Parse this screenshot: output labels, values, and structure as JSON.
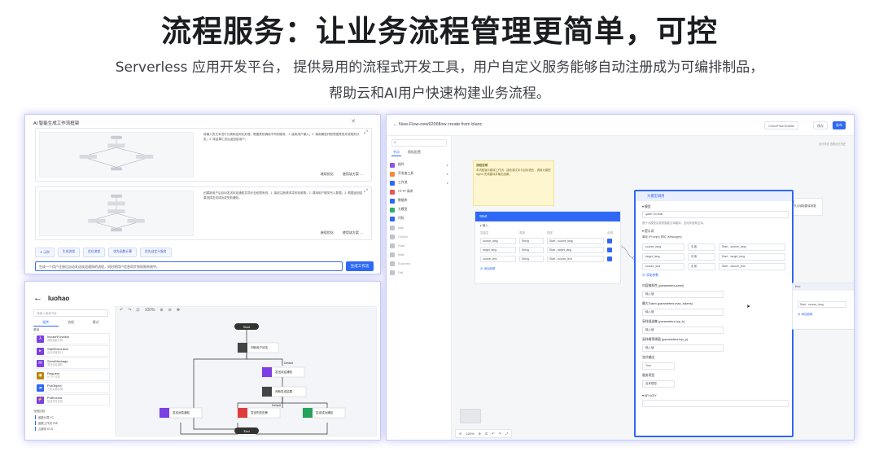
{
  "headline": "流程服务：让业务流程管理更简单，可控",
  "subline1": "Serverless 应用开发平台， 提供易用的流程式开发工具，用户自定义服务能够自动注册成为可编排制品，",
  "subline2": "帮助云和AI用户快速构建业务流程。",
  "panel1": {
    "title": "AI 智能生成工作流框架",
    "close": "✕",
    "cards": [
      {
        "text": "将输入的文本进行分类和结构化处理，根据类别调用不同的服务。1. 接收用户输入；2. 调用模型判断意图类别并按规则分发；3. 将结果汇总后返回给用户。",
        "optimize": "继续优化",
        "use": "使用该方案 →"
      },
      {
        "text": "创建新用户后自动发送欢迎通知并同步至权限系统。1. 接收注册请求并校验参数；2. 调用用户服务写入数据；3. 根据返回结果选择发送成功或失败通知。",
        "optimize": "继续优化",
        "use": "使用该方案 →"
      }
    ],
    "tags": [
      "✦ 示例",
      "生成流程",
      "优化流程",
      "优先函数计算",
      "优先自定义服务"
    ],
    "input": "生成一个用户注册后自动发送欢迎通知的流程，同时将用户信息同步到权限系统中。",
    "generate": "生成工作流"
  },
  "panel2": {
    "back": "←",
    "title": "luohao",
    "search": "请输入搜索内容",
    "tabs": [
      "组件",
      "流程",
      "模式"
    ],
    "group": "基础",
    "nodes": [
      {
        "name": "InvokeFunction",
        "sub": "调用函数计算",
        "color": "#7b3fe4"
      },
      {
        "name": "StartExecution",
        "sub": "启动流程执行",
        "color": "#7b3fe4"
      },
      {
        "name": "SendMessage",
        "sub": "发送消息通知",
        "color": "#7b3fe4"
      },
      {
        "name": "Request",
        "sub": "HTTP 请求",
        "color": "#b8860b"
      },
      {
        "name": "PutObject",
        "sub": "上传对象存储",
        "color": "#2f68f5"
      },
      {
        "name": "PutEvents",
        "sub": "投递事件总线",
        "color": "#7b3fe4"
      }
    ],
    "section": "流程控制",
    "subs": [
      "函数计算 FC",
      "函数工作流 FNF",
      "云服务 ECS"
    ],
    "toolbar": [
      "↶",
      "↷",
      "⊡",
      "100%",
      "⊕",
      "⊖",
      "✥"
    ],
    "flow": {
      "start": "Start",
      "end": "End",
      "judge1": "判断用户状态",
      "invoke": "发送欢迎通知",
      "judge2": "判断发送结果",
      "default": "Default",
      "b1": "发送消息通知",
      "b2": "发送失败告警",
      "b3": "发送成功通知"
    }
  },
  "panel3": {
    "title": "←  New-Flow-new9206flow create from blanc",
    "topbtn1": "CloudFlow Builder",
    "topbtn2": "保存",
    "topbtn3": "发布",
    "search": "⌕",
    "tabs": [
      "节点",
      "模板配置"
    ],
    "items": [
      {
        "label": "插件",
        "color": "#8a58e8"
      },
      {
        "label": "开发者工具",
        "color": "#f58a3c"
      },
      {
        "label": "工作流",
        "color": "#2f68f5"
      },
      {
        "label": "HTTP 请求",
        "color": "#e95656"
      },
      {
        "label": "数据库",
        "color": "#2f68f5"
      },
      {
        "label": "大模型",
        "color": "#2fb06a"
      },
      {
        "label": "代码",
        "color": "#2f68f5"
      },
      {
        "label": "Map",
        "color": "#c0c4cc"
      },
      {
        "label": "Choice",
        "color": "#c0c4cc"
      },
      {
        "label": "Pass",
        "color": "#c0c4cc"
      },
      {
        "label": "Wait",
        "color": "#c0c4cc"
      },
      {
        "label": "Succeed",
        "color": "#c0c4cc"
      },
      {
        "label": "Fail",
        "color": "#c0c4cc"
      }
    ],
    "hint": "运行状态    查看运行历史",
    "note_title": "流程说明",
    "note": "本流程演示翻译工作流：接收源文本与目标语言，调用大模型 Agent 完成翻译并输出结果。",
    "start_title": "Start",
    "start_input": "▸ 输入",
    "start_cols": [
      "变量名",
      "类型",
      "描述",
      "必填"
    ],
    "start_rows": [
      [
        "source_lang",
        "String",
        "Start - source_lang"
      ],
      [
        "target_lang",
        "String",
        "Start - target_lang"
      ],
      [
        "source_text",
        "String",
        "Start - source_text"
      ]
    ],
    "start_add": "⊕ 添加参数",
    "llm_title": "大模型调用",
    "llm_model_label": "▾ 模型",
    "llm_model": "qwen-7b-chat",
    "llm_desc": "基于大模型实现的智能文本翻译，支持多语种互译。",
    "llm_prompt_label": "▾ 提示词",
    "llm_prompt": "单轮 (Prompt)    多轮 (Messages)",
    "llm_rows": [
      [
        "source_lang",
        "引用",
        "Start - source_lang"
      ],
      [
        "target_lang",
        "引用",
        "Start - target_lang"
      ],
      [
        "source_text",
        "引用",
        "Start - source_text"
      ]
    ],
    "llm_add": "⊕ 添加参数",
    "params": [
      {
        "label": "内容随机性 (parameters.seed)",
        "value": "输入值"
      },
      {
        "label": "最大Token (parameters.max_tokens)",
        "value": "输入值"
      },
      {
        "label": "采样候选集 (parameters.top_k)",
        "value": "输入值"
      },
      {
        "label": "采样概率阈值 (parameters.top_p)",
        "value": "输入值"
      },
      {
        "label": "流式输出",
        "value": "True"
      },
      {
        "label": "服务类型",
        "value": "百炼模型"
      },
      {
        "label": "▾ API-KEY",
        "value": ""
      }
    ],
    "end_title": "End",
    "end_row": "Start - source_lang",
    "end_add": "⊕ 添加参数",
    "tip_title": "变量说明",
    "tip": "从 Start 节点读取翻译参数",
    "zoom": [
      "⊖",
      "100%",
      "⊕",
      "⊡",
      "↶",
      "↷",
      "⤢"
    ]
  }
}
